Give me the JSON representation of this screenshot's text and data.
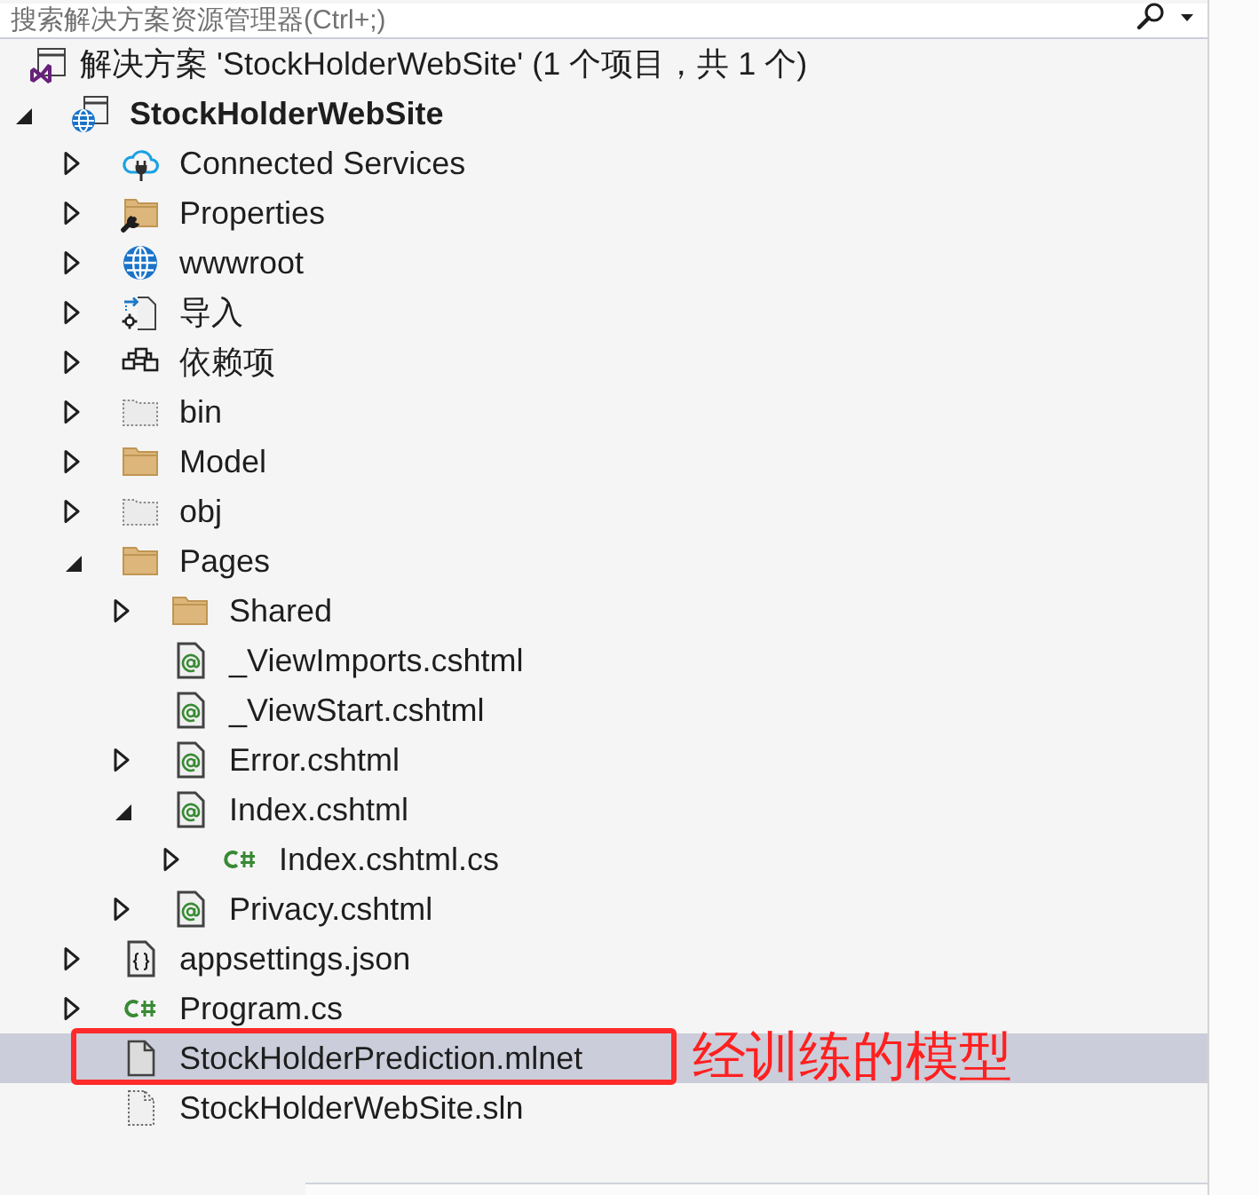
{
  "search": {
    "placeholder": "搜索解决方案资源管理器(Ctrl+;)"
  },
  "tree": [
    {
      "label": "解决方案 'StockHolderWebSite' (1 个项目，共 1 个)",
      "kind": "solution",
      "selected": false,
      "children": [
        {
          "label": "StockHolderWebSite",
          "kind": "web-project",
          "expanded": true,
          "selected": false,
          "children": [
            {
              "label": "Connected Services",
              "kind": "connected-services",
              "expanded": false,
              "selected": false
            },
            {
              "label": "Properties",
              "kind": "properties",
              "expanded": false,
              "selected": false
            },
            {
              "label": "wwwroot",
              "kind": "web-root",
              "expanded": false,
              "selected": false
            },
            {
              "label": "导入",
              "kind": "imports",
              "expanded": false,
              "selected": false
            },
            {
              "label": "依赖项",
              "kind": "dependencies",
              "expanded": false,
              "selected": false
            },
            {
              "label": "bin",
              "kind": "hidden-folder",
              "expanded": false,
              "selected": false
            },
            {
              "label": "Model",
              "kind": "folder",
              "expanded": false,
              "selected": false
            },
            {
              "label": "obj",
              "kind": "hidden-folder",
              "expanded": false,
              "selected": false
            },
            {
              "label": "Pages",
              "kind": "folder",
              "expanded": true,
              "selected": false,
              "children": [
                {
                  "label": "Shared",
                  "kind": "folder",
                  "expanded": false,
                  "selected": false
                },
                {
                  "label": "_ViewImports.cshtml",
                  "kind": "razor-file",
                  "selected": false
                },
                {
                  "label": "_ViewStart.cshtml",
                  "kind": "razor-file",
                  "selected": false
                },
                {
                  "label": "Error.cshtml",
                  "kind": "razor-file",
                  "expanded": false,
                  "selected": false
                },
                {
                  "label": "Index.cshtml",
                  "kind": "razor-file",
                  "expanded": true,
                  "selected": false,
                  "children": [
                    {
                      "label": "Index.cshtml.cs",
                      "kind": "csharp-file",
                      "expanded": false,
                      "selected": false
                    }
                  ]
                },
                {
                  "label": "Privacy.cshtml",
                  "kind": "razor-file",
                  "expanded": false,
                  "selected": false
                }
              ]
            },
            {
              "label": "appsettings.json",
              "kind": "json-file",
              "expanded": false,
              "selected": false
            },
            {
              "label": "Program.cs",
              "kind": "csharp-file",
              "expanded": false,
              "selected": false
            },
            {
              "label": "StockHolderPrediction.mlnet",
              "kind": "file",
              "selected": true,
              "annotation": "经训练的模型"
            },
            {
              "label": "StockHolderWebSite.sln",
              "kind": "solution-file",
              "selected": false
            }
          ]
        }
      ]
    }
  ]
}
